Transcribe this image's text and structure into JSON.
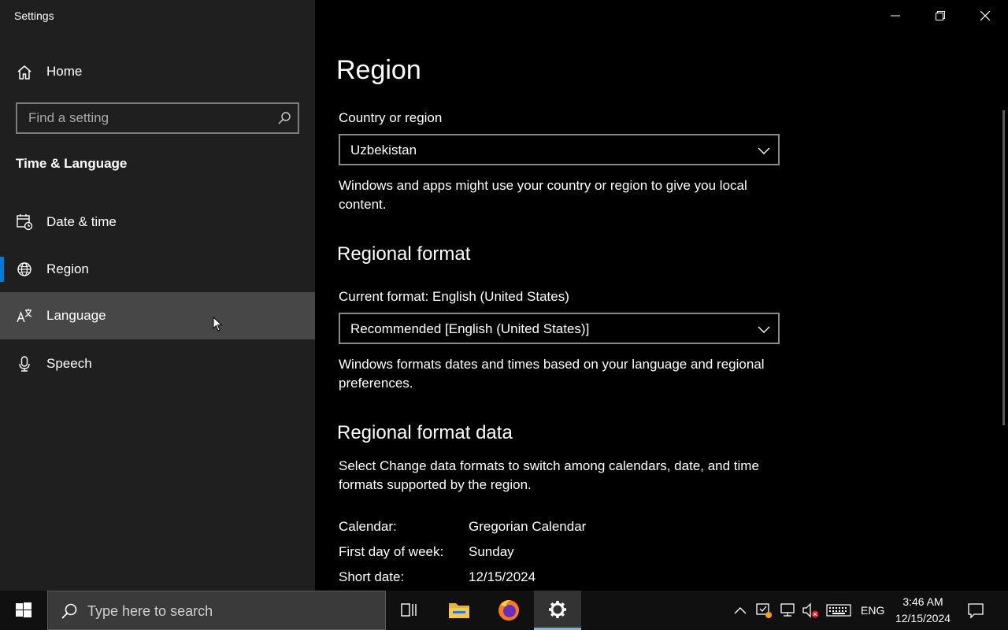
{
  "window": {
    "title": "Settings"
  },
  "sidebar": {
    "home_label": "Home",
    "search_placeholder": "Find a setting",
    "section_title": "Time & Language",
    "items": [
      {
        "label": "Date & time",
        "icon": "calendar-clock-icon"
      },
      {
        "label": "Region",
        "icon": "globe-icon",
        "selected": true
      },
      {
        "label": "Language",
        "icon": "language-icon",
        "hover": true
      },
      {
        "label": "Speech",
        "icon": "microphone-icon"
      }
    ]
  },
  "main": {
    "title": "Region",
    "country": {
      "label": "Country or region",
      "value": "Uzbekistan",
      "description": "Windows and apps might use your country or region to give you local content."
    },
    "regional_format": {
      "heading": "Regional format",
      "current_label": "Current format: English (United States)",
      "value": "Recommended [English (United States)]",
      "description": "Windows formats dates and times based on your language and regional preferences."
    },
    "format_data": {
      "heading": "Regional format data",
      "description": "Select Change data formats to switch among calendars, date, and time formats supported by the region.",
      "rows": [
        {
          "key": "Calendar:",
          "value": "Gregorian Calendar"
        },
        {
          "key": "First day of week:",
          "value": "Sunday"
        },
        {
          "key": "Short date:",
          "value": "12/15/2024"
        }
      ]
    }
  },
  "taskbar": {
    "search_placeholder": "Type here to search",
    "language": "ENG",
    "time": "3:46 AM",
    "date": "12/15/2024"
  },
  "colors": {
    "accent": "#0078d7",
    "sidebar_bg": "#1f1f1f",
    "hover_bg": "#474747"
  }
}
